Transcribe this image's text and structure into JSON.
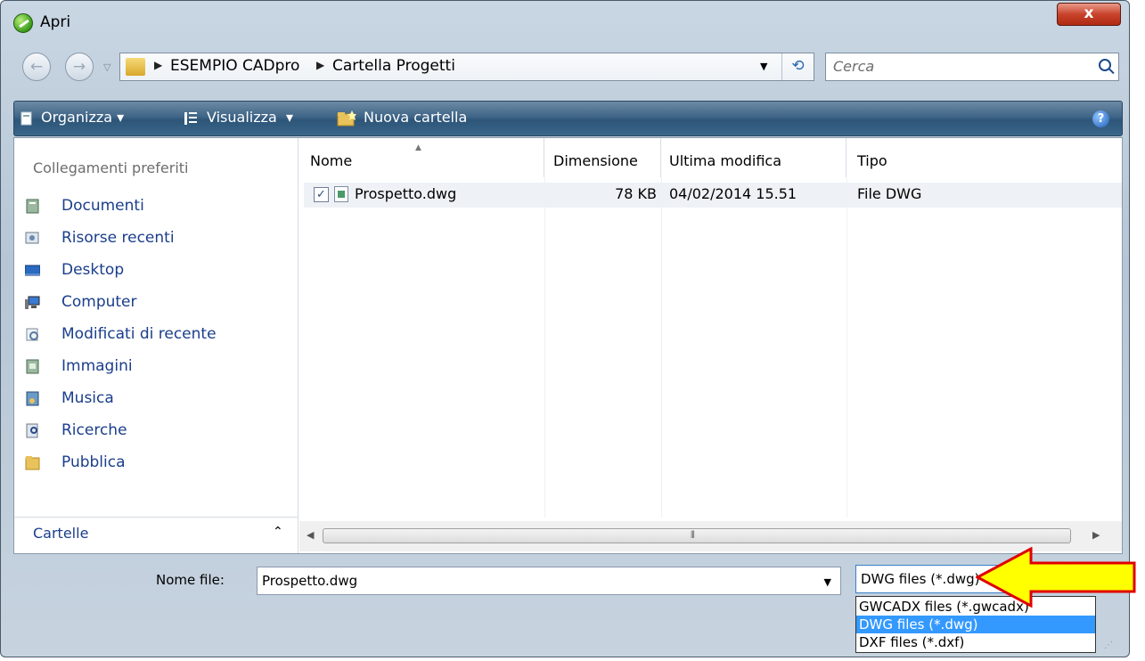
{
  "window": {
    "title": "Apri",
    "close_label": "x"
  },
  "nav": {
    "back_glyph": "←",
    "forward_glyph": "→",
    "breadcrumb": [
      "ESEMPIO CADpro",
      "Cartella Progetti"
    ],
    "search_placeholder": "Cerca"
  },
  "toolbar": {
    "organize_label": "Organizza",
    "view_label": "Visualizza",
    "new_folder_label": "Nuova cartella"
  },
  "sidebar": {
    "header": "Collegamenti preferiti",
    "items": [
      {
        "label": "Documenti",
        "icon": "documents-icon"
      },
      {
        "label": "Risorse recenti",
        "icon": "recent-places-icon"
      },
      {
        "label": "Desktop",
        "icon": "desktop-icon"
      },
      {
        "label": "Computer",
        "icon": "computer-icon"
      },
      {
        "label": "Modificati di recente",
        "icon": "recently-changed-icon"
      },
      {
        "label": "Immagini",
        "icon": "pictures-icon"
      },
      {
        "label": "Musica",
        "icon": "music-icon"
      },
      {
        "label": "Ricerche",
        "icon": "searches-icon"
      },
      {
        "label": "Pubblica",
        "icon": "public-folder-icon"
      }
    ],
    "folders_label": "Cartelle"
  },
  "filelist": {
    "columns": [
      "Nome",
      "Dimensione",
      "Ultima modifica",
      "Tipo"
    ],
    "rows": [
      {
        "name": "Prospetto.dwg",
        "size": "78 KB",
        "modified": "04/02/2014 15.51",
        "type": "File DWG",
        "checked": true
      }
    ]
  },
  "bottom": {
    "filename_label": "Nome file:",
    "filename_value": "Prospetto.dwg",
    "filetype_selected": "DWG files (*.dwg)",
    "filetype_options": [
      "GWCADX files (*.gwcadx)",
      "DWG files (*.dwg)",
      "DXF files (*.dxf)"
    ]
  },
  "colors": {
    "toolbar": "#3f6587",
    "link": "#1a3e8c",
    "selection": "#3399ff",
    "arrow": "#ffff00"
  }
}
